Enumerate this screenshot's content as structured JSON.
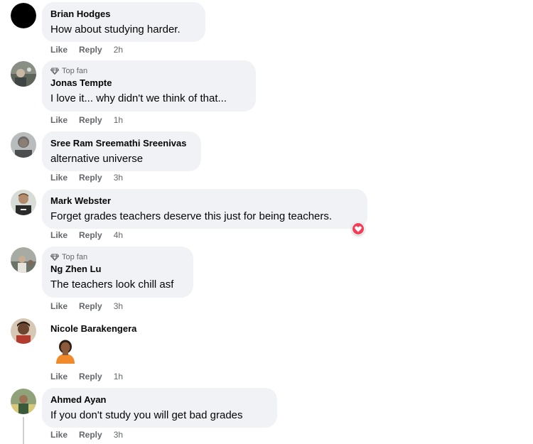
{
  "comments": [
    {
      "author": "Brian Hodges",
      "text": "How about studying harder.",
      "like_label": "Like",
      "reply_label": "Reply",
      "time": "2h",
      "top_fan": false
    },
    {
      "author": "Jonas Tempte",
      "text": "I love it... why didn't we think of that...",
      "like_label": "Like",
      "reply_label": "Reply",
      "time": "1h",
      "top_fan": true,
      "badge": "Top fan"
    },
    {
      "author": "Sree Ram Sreemathi Sreenivas",
      "text": "alternative universe",
      "like_label": "Like",
      "reply_label": "Reply",
      "time": "3h",
      "top_fan": false
    },
    {
      "author": "Mark Webster",
      "text": "Forget grades teachers deserve this just for being teachers.",
      "like_label": "Like",
      "reply_label": "Reply",
      "time": "4h",
      "top_fan": false,
      "reaction": "love-reaction-icon"
    },
    {
      "author": "Ng Zhen Lu",
      "text": "The teachers look chill asf",
      "like_label": "Like",
      "reply_label": "Reply",
      "time": "3h",
      "top_fan": true,
      "badge": "Top fan"
    },
    {
      "author": "Nicole Barakengera",
      "text": "",
      "attachment": "person-emoji-sticker",
      "like_label": "Like",
      "reply_label": "Reply",
      "time": "1h",
      "top_fan": false
    },
    {
      "author": "Ahmed Ayan",
      "text": "If you don't study you will get bad grades",
      "like_label": "Like",
      "reply_label": "Reply",
      "time": "3h",
      "top_fan": false
    }
  ],
  "colors": {
    "bubble": "#f0f2f5",
    "secondary_text": "#65676b",
    "love_reaction": "#f33e58"
  }
}
